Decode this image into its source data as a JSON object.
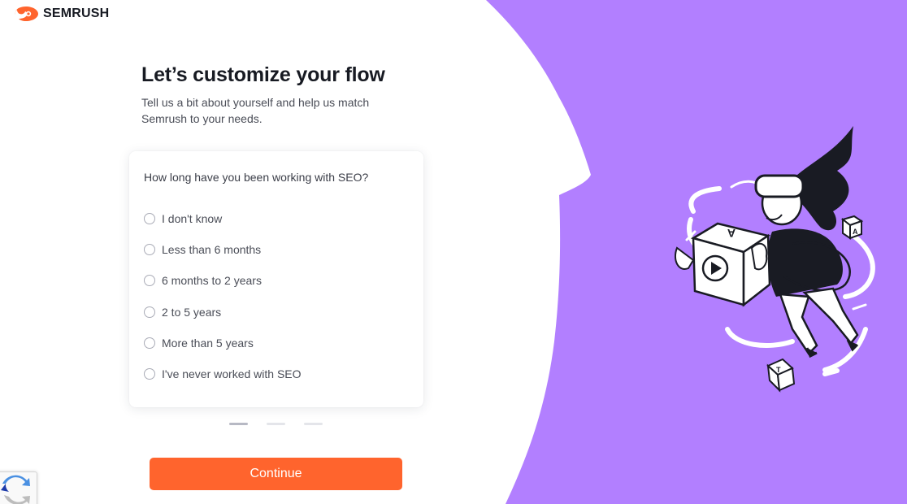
{
  "brand": {
    "name": "SEMRUSH",
    "logo_icon": "semrush-flame-icon",
    "accent": "#ff642d"
  },
  "page": {
    "title": "Let’s customize your flow",
    "subtitle": "Tell us a bit about yourself and help us match Semrush to your needs."
  },
  "survey": {
    "question": "How long have you been working with SEO?",
    "options": [
      {
        "label": "I don't know"
      },
      {
        "label": "Less than 6 months"
      },
      {
        "label": "6 months to 2 years"
      },
      {
        "label": "2 to 5 years"
      },
      {
        "label": "More than 5 years"
      },
      {
        "label": "I've never worked with SEO"
      }
    ],
    "steps_total": 3,
    "current_step": 1
  },
  "actions": {
    "continue_label": "Continue"
  },
  "colors": {
    "purple_panel": "#b27fff",
    "card_bg": "#ffffff",
    "button_bg": "#ff642d"
  },
  "illustration": {
    "name": "vr-headset-person-with-cubes",
    "cube_letters": [
      "A",
      "A",
      "T"
    ]
  },
  "recaptcha": {
    "icon": "recaptcha-icon"
  }
}
